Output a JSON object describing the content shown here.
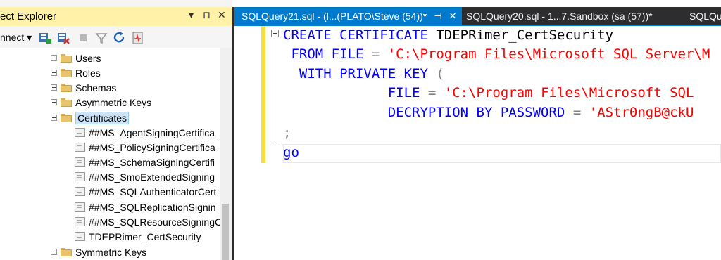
{
  "object_explorer": {
    "title": "ect Explorer",
    "pin_glyph": "▾ ⊓",
    "close_glyph": "✕",
    "connect_label": "nnect ▾",
    "tree": [
      {
        "label": "Users",
        "kind": "folder",
        "expander": "plus"
      },
      {
        "label": "Roles",
        "kind": "folder",
        "expander": "plus"
      },
      {
        "label": "Schemas",
        "kind": "folder",
        "expander": "plus"
      },
      {
        "label": "Asymmetric Keys",
        "kind": "folder",
        "expander": "plus"
      },
      {
        "label": "Certificates",
        "kind": "folder",
        "expander": "minus",
        "selected": true
      },
      {
        "label": "##MS_AgentSigningCertifica",
        "kind": "cert"
      },
      {
        "label": "##MS_PolicySigningCertifica",
        "kind": "cert"
      },
      {
        "label": "##MS_SchemaSigningCertifi",
        "kind": "cert"
      },
      {
        "label": "##MS_SmoExtendedSigning",
        "kind": "cert"
      },
      {
        "label": "##MS_SQLAuthenticatorCert",
        "kind": "cert"
      },
      {
        "label": "##MS_SQLReplicationSignin",
        "kind": "cert"
      },
      {
        "label": "##MS_SQLResourceSigningC",
        "kind": "cert"
      },
      {
        "label": "TDEPRimer_CertSecurity",
        "kind": "cert"
      },
      {
        "label": "Symmetric Keys",
        "kind": "folder",
        "expander": "plus"
      }
    ],
    "toolbar_icons": [
      "connect-server-icon",
      "disconnect-icon",
      "stop-icon",
      "filter-icon",
      "refresh-icon",
      "activity-monitor-icon"
    ]
  },
  "tabs": [
    {
      "label": "SQLQuery21.sql - (l...(PLATO\\Steve (54))*",
      "active": true,
      "pin": "⊣",
      "close": "✕"
    },
    {
      "label": "SQLQuery20.sql - 1...7.Sandbox (sa (57))*",
      "active": false
    },
    {
      "label": "SQLQuer",
      "active": false
    }
  ],
  "editor": {
    "lines": [
      [
        {
          "t": "CREATE CERTIFICATE",
          "c": "kw"
        },
        {
          "t": " TDEPRimer_CertSecurity",
          "c": "plain"
        }
      ],
      [
        {
          "t": " FROM FILE",
          "c": "kw"
        },
        {
          "t": " = ",
          "c": "punct"
        },
        {
          "t": "'C:\\Program Files\\Microsoft SQL Server\\M",
          "c": "str"
        }
      ],
      [
        {
          "t": "  WITH PRIVATE KEY",
          "c": "kw"
        },
        {
          "t": " (",
          "c": "punct"
        }
      ],
      [
        {
          "t": "             FILE",
          "c": "kw"
        },
        {
          "t": " = ",
          "c": "punct"
        },
        {
          "t": "'C:\\Program Files\\Microsoft SQL",
          "c": "str"
        }
      ],
      [
        {
          "t": "             DECRYPTION BY PASSWORD",
          "c": "kw"
        },
        {
          "t": " = ",
          "c": "punct"
        },
        {
          "t": "'AStr0ngB@ckU",
          "c": "str"
        }
      ],
      [
        {
          "t": ";",
          "c": "punct"
        }
      ],
      [
        {
          "t": "go",
          "c": "kw"
        }
      ]
    ]
  },
  "colors": {
    "active_tab": "#007acc",
    "title_highlight": "#fff1a8",
    "keyword": "#0000ff",
    "string": "#ff0000"
  }
}
